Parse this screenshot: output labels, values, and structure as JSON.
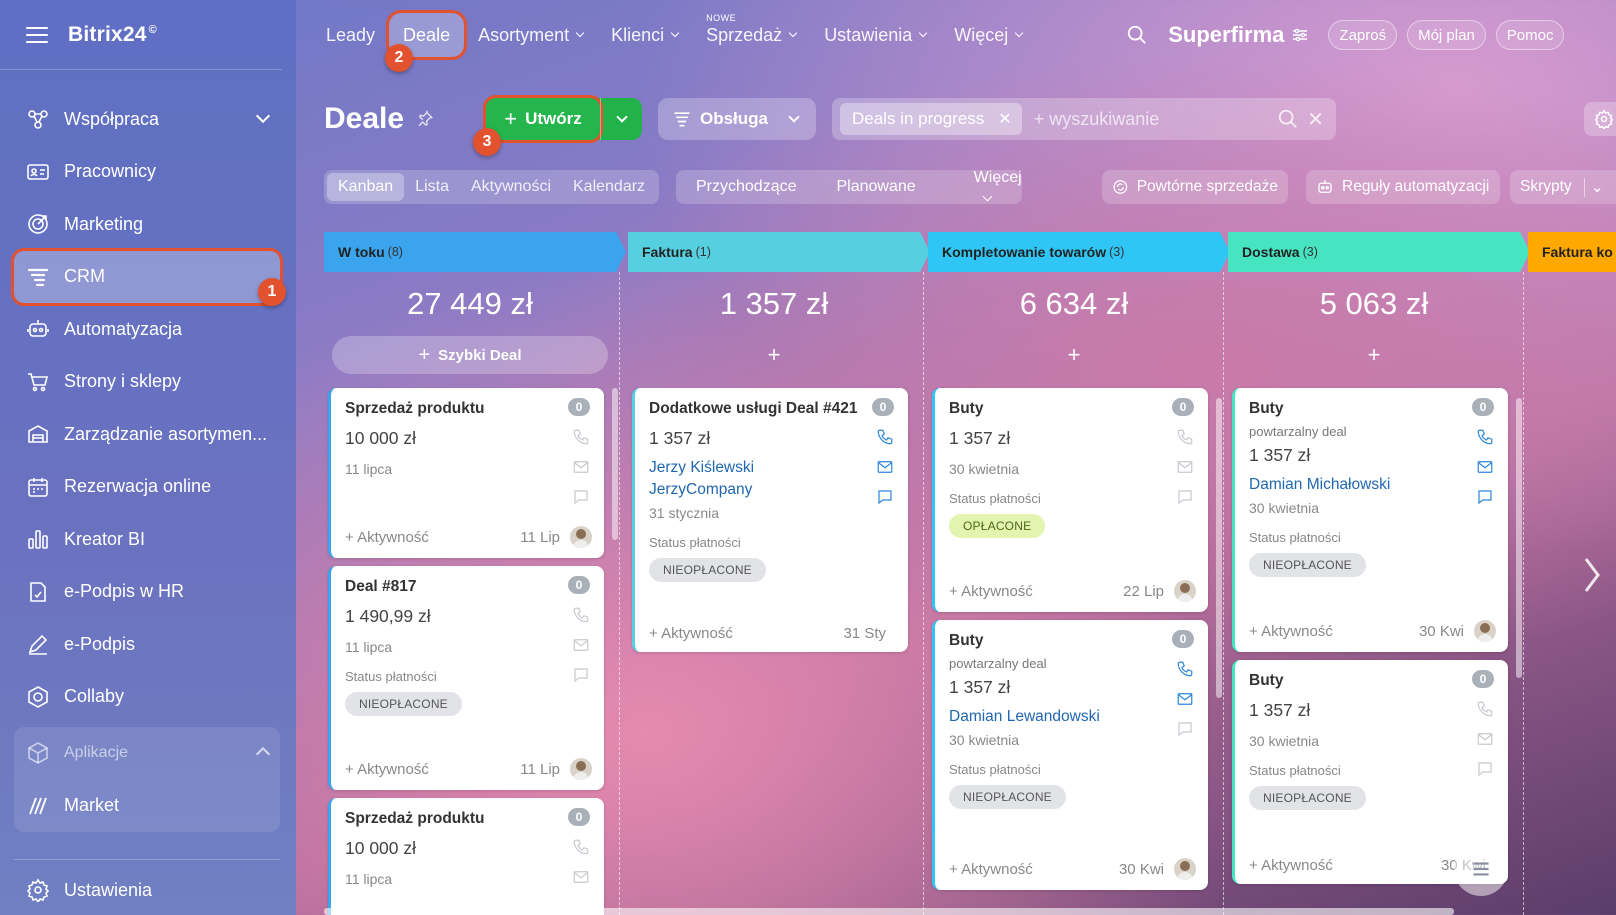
{
  "app": {
    "logo": "Bitrix24",
    "logo_mark": "©"
  },
  "sidebar": {
    "items": [
      {
        "label": "Współpraca",
        "icon": "chat-bubbles-icon"
      },
      {
        "label": "Pracownicy",
        "icon": "id-card-icon"
      },
      {
        "label": "Marketing",
        "icon": "target-icon"
      },
      {
        "label": "CRM",
        "icon": "funnel-icon"
      },
      {
        "label": "Automatyzacja",
        "icon": "robot-icon"
      },
      {
        "label": "Strony i sklepy",
        "icon": "cart-icon"
      },
      {
        "label": "Zarządzanie asortymen...",
        "icon": "warehouse-icon"
      },
      {
        "label": "Rezerwacja online",
        "icon": "calendar-icon"
      },
      {
        "label": "Kreator BI",
        "icon": "bar-chart-icon"
      },
      {
        "label": "e-Podpis w HR",
        "icon": "doc-sign-icon"
      },
      {
        "label": "e-Podpis",
        "icon": "pen-icon"
      },
      {
        "label": "Collaby",
        "icon": "hexagon-icon"
      }
    ],
    "apps_label": "Aplikacje",
    "apps_items": [
      {
        "label": "Market",
        "icon": "market-icon"
      }
    ],
    "settings_label": "Ustawienia"
  },
  "topnav": {
    "items": [
      "Leady",
      "Deale",
      "Asortyment",
      "Klienci",
      "Sprzedaż",
      "Ustawienia",
      "Więcej"
    ],
    "new_label": "NOWE",
    "company": "Superfirma",
    "pills": [
      "Zaproś",
      "Mój plan",
      "Pomoc"
    ]
  },
  "toolbar": {
    "title": "Deale",
    "create_label": "Utwórz",
    "service_label": "Obsługa",
    "filter_tag": "Deals in progress",
    "search_placeholder": "+ wyszukiwanie"
  },
  "views": [
    "Kanban",
    "Lista",
    "Aktywności",
    "Kalendarz"
  ],
  "categories": [
    "Przychodzące",
    "Planowane",
    "Więcej"
  ],
  "actions": [
    "Powtórne sprzedaże",
    "Reguły automatyzacji",
    "Skrypty"
  ],
  "annotations": [
    "1",
    "2",
    "3"
  ],
  "kanban": {
    "quick_deal": "Szybki Deal",
    "add_activity": "+ Aktywność",
    "columns": [
      {
        "title": "W toku",
        "count": "(8)",
        "sum": "27 449 zł",
        "color": "#3aa5ee",
        "cards": [
          {
            "title": "Sprzedaż produktu",
            "amount": "10 000 zł",
            "date": "11 lipca",
            "badge": "0",
            "foot_date": "11 Lip"
          },
          {
            "title": "Deal #817",
            "amount": "1 490,99 zł",
            "date": "11 lipca",
            "status_label": "Status płatności",
            "status": "NIEOPŁACONE",
            "badge": "0",
            "foot_date": "11 Lip"
          },
          {
            "title": "Sprzedaż produktu",
            "amount": "10 000 zł",
            "date": "11 lipca",
            "badge": "0"
          }
        ]
      },
      {
        "title": "Faktura",
        "count": "(1)",
        "sum": "1 357 zł",
        "color": "#56cfe1",
        "cards": [
          {
            "title": "Dodatkowe usługi Deal #421",
            "amount": "1 357 zł",
            "contact": "Jerzy Kiślewski",
            "company": "JerzyCompany",
            "date": "31 stycznia",
            "status_label": "Status płatności",
            "status": "NIEOPŁACONE",
            "badge": "0",
            "foot_date": "31 Sty"
          }
        ]
      },
      {
        "title": "Kompletowanie towarów",
        "count": "(3)",
        "sum": "6 634 zł",
        "color": "#2fc6f6",
        "cards": [
          {
            "title": "Buty",
            "amount": "1 357 zł",
            "date": "30 kwietnia",
            "status_label": "Status płatności",
            "status": "OPŁACONE",
            "badge": "0",
            "foot_date": "22 Lip"
          },
          {
            "title": "Buty",
            "subtitle": "powtarzalny deal",
            "amount": "1 357 zł",
            "contact": "Damian Lewandowski",
            "date": "30 kwietnia",
            "status_label": "Status płatności",
            "status": "NIEOPŁACONE",
            "badge": "0",
            "foot_date": "30 Kwi"
          }
        ]
      },
      {
        "title": "Dostawa",
        "count": "(3)",
        "sum": "5 063 zł",
        "color": "#47e4c2",
        "cards": [
          {
            "title": "Buty",
            "subtitle": "powtarzalny deal",
            "amount": "1 357 zł",
            "contact": "Damian Michałowski",
            "date": "30 kwietnia",
            "status_label": "Status płatności",
            "status": "NIEOPŁACONE",
            "badge": "0",
            "foot_date": "30 Kwi"
          },
          {
            "title": "Buty",
            "amount": "1 357 zł",
            "date": "30 kwietnia",
            "status_label": "Status płatności",
            "status": "NIEOPŁACONE",
            "badge": "0",
            "foot_date": "30 Kwi"
          }
        ]
      },
      {
        "title": "Faktura ko",
        "color": "#ffa900"
      }
    ]
  }
}
